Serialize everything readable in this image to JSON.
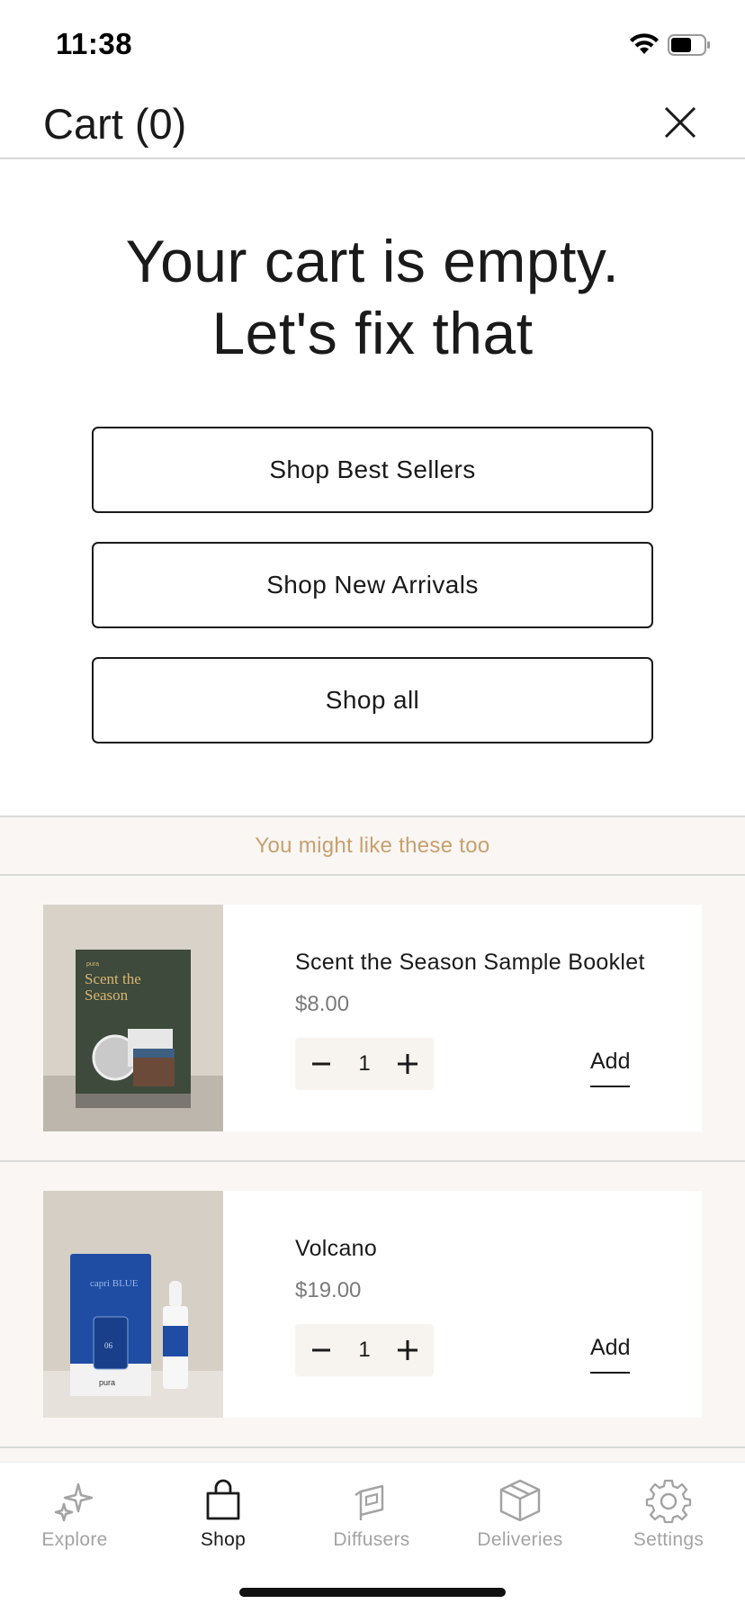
{
  "status_bar": {
    "time": "11:38"
  },
  "header": {
    "title": "Cart (0)",
    "close_icon": "close-icon"
  },
  "empty_state": {
    "title_line1": "Your cart is empty.",
    "title_line2": "Let's fix that",
    "buttons": [
      "Shop Best Sellers",
      "Shop New Arrivals",
      "Shop all"
    ]
  },
  "recommendations": {
    "heading": "You might like these too",
    "products": [
      {
        "name": "Scent the Season Sample Booklet",
        "price": "$8.00",
        "quantity": "1",
        "add_label": "Add",
        "image_text_brand": "pura",
        "image_text_title1": "Scent the",
        "image_text_title2": "Season"
      },
      {
        "name": "Volcano",
        "price": "$19.00",
        "quantity": "1",
        "add_label": "Add",
        "image_text_brand": "capri BLUE",
        "image_text_num": "06",
        "image_text_label": "pura"
      }
    ]
  },
  "tab_bar": {
    "tabs": [
      {
        "label": "Explore",
        "icon": "sparkles-icon",
        "active": false
      },
      {
        "label": "Shop",
        "icon": "shopping-bag-icon",
        "active": true
      },
      {
        "label": "Diffusers",
        "icon": "diffuser-icon",
        "active": false
      },
      {
        "label": "Deliveries",
        "icon": "package-icon",
        "active": false
      },
      {
        "label": "Settings",
        "icon": "gear-icon",
        "active": false
      }
    ]
  },
  "colors": {
    "accent_gold": "#c7a06e",
    "section_bg": "#f9f6f3",
    "text": "#1a1a1a",
    "muted": "#a3a3a3"
  }
}
